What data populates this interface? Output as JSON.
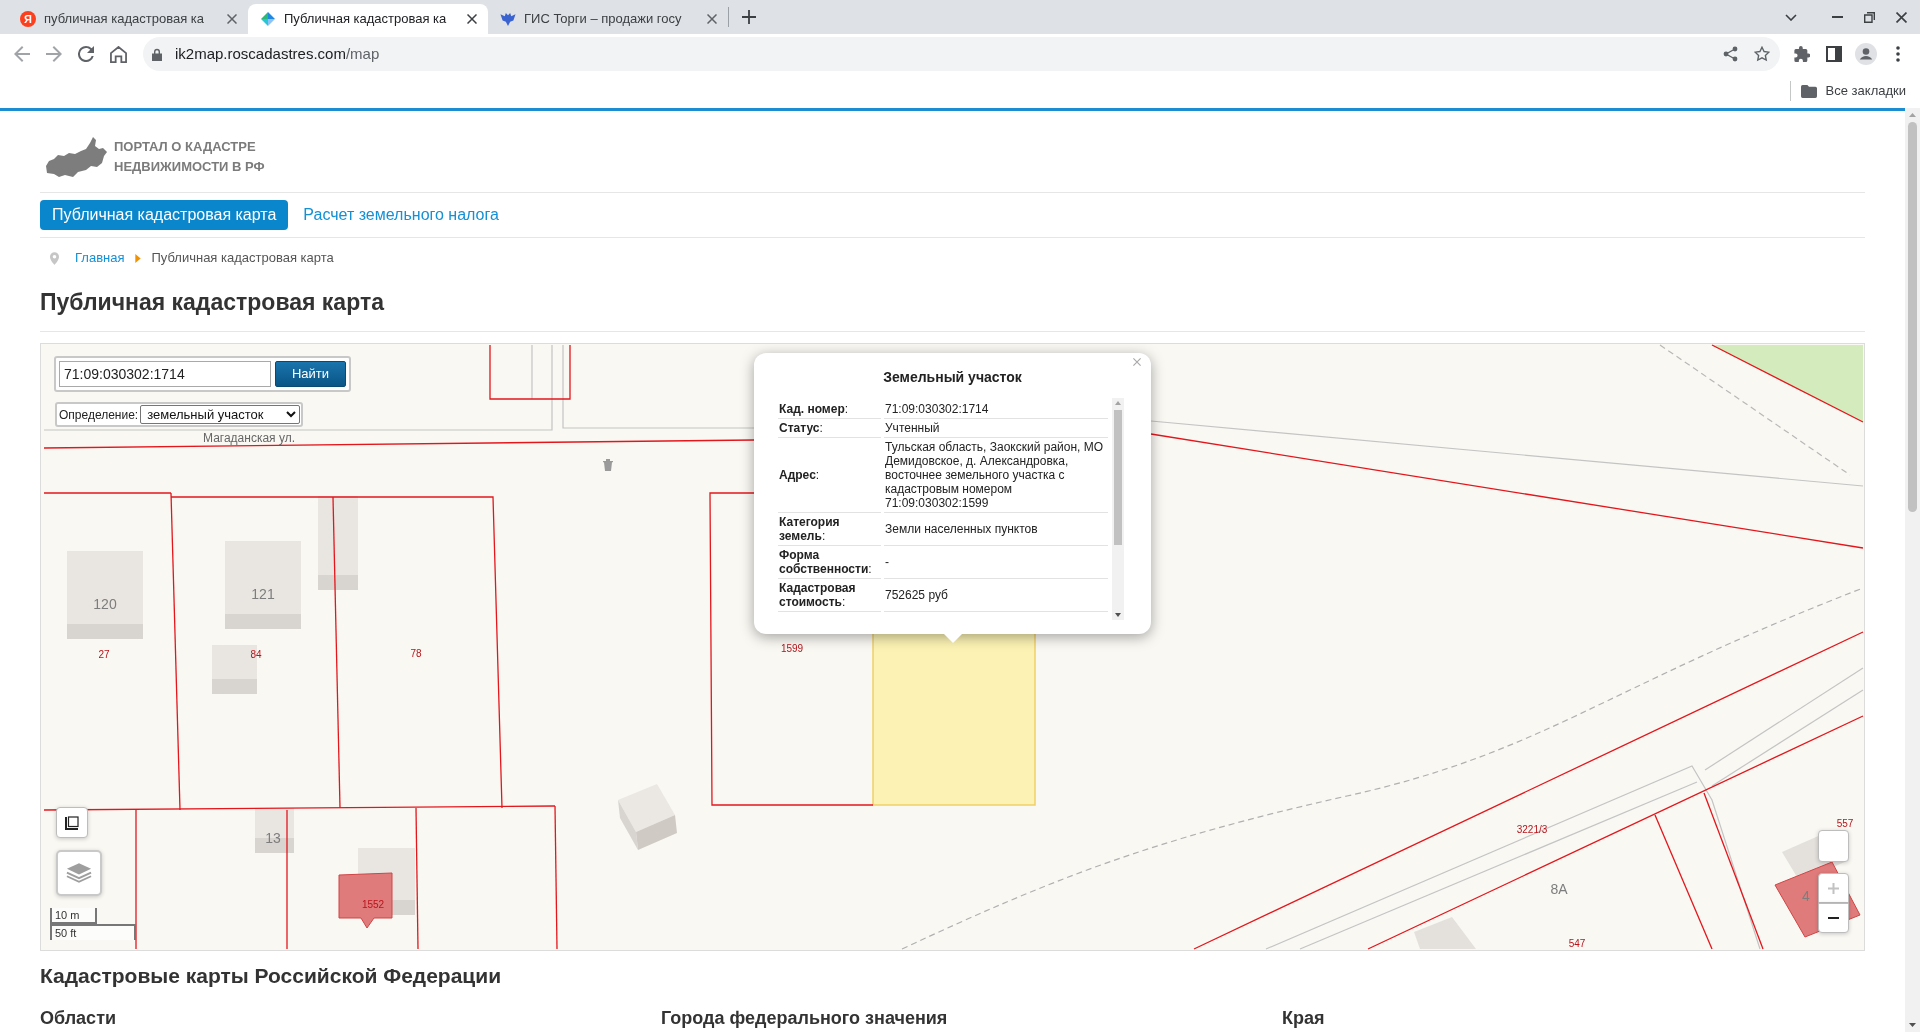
{
  "browser": {
    "tabs": [
      {
        "title": "публичная кадастровая ка",
        "favicon": {
          "kind": "letter",
          "text": "Я"
        },
        "selected": false
      },
      {
        "title": "Публичная кадастровая ка",
        "favicon": {
          "kind": "triangles"
        },
        "selected": true
      },
      {
        "title": "ГИС Торги – продажи госу",
        "favicon": {
          "kind": "emblem"
        },
        "selected": false
      }
    ],
    "address": {
      "host": "ik2map.roscadastres.com",
      "path": "/map"
    },
    "bookmarks_folder": "Все закладки"
  },
  "site": {
    "logo_lines": [
      "ПОРТАЛ О КАДАСТРЕ",
      "НЕДВИЖИМОСТИ В РФ"
    ],
    "menu": [
      {
        "label": "Публичная кадастровая карта",
        "selected": true
      },
      {
        "label": "Расчет земельного налога",
        "selected": false
      }
    ],
    "breadcrumb": [
      {
        "label": "Главная",
        "kind": "link"
      },
      {
        "label": "Публичная кадастровая карта",
        "kind": "current"
      }
    ],
    "title": "Публичная кадастровая карта"
  },
  "map": {
    "search": {
      "value": "71:09:030302:1714",
      "button": "Найти"
    },
    "definition": {
      "label": "Определение:",
      "value": "земельный участок"
    },
    "street": "Магаданская ул.",
    "parcel_numbers": [
      "27",
      "84",
      "78",
      "1599",
      "1552",
      "3221/3",
      "547",
      "557"
    ],
    "building_numbers": [
      "120",
      "121",
      "13",
      "8А",
      "4"
    ],
    "popup": {
      "title": "Земельный участок",
      "rows": [
        {
          "label": "**Кад. номер**:",
          "value": "71:09:030302:1714"
        },
        {
          "label": "**Статус**:",
          "value": "Учтенный"
        },
        {
          "label": "**Адрес**:",
          "value": "Тульская область, Заокский район, МО Демидовское, д. Александровка, восточнее земельного участка с кадастровым номером 71:09:030302:1599"
        },
        {
          "label": "**Категория земель**:",
          "value": "Земли населенных пунктов"
        },
        {
          "label": "**Форма собственности**:",
          "value": "-"
        },
        {
          "label": "**Кадастровая стоимость**:",
          "value": "752625 руб"
        }
      ]
    },
    "scale": [
      "10 m",
      "50 ft"
    ],
    "zoom": [
      {
        "kind": "in",
        "disabled": true
      },
      {
        "kind": "out",
        "disabled": false
      }
    ]
  },
  "section": {
    "title": "Кадастровые карты Российской Федерации",
    "columns": [
      "Области",
      "Города федерального значения",
      "Края"
    ]
  }
}
